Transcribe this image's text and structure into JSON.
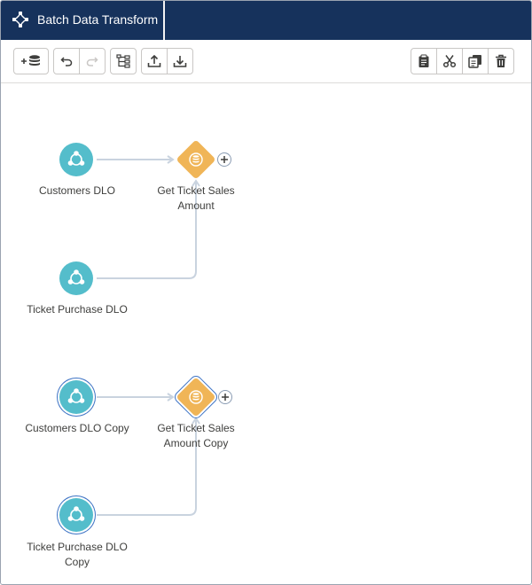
{
  "app": {
    "title": "Batch Data Transform",
    "icon": "transform-icon"
  },
  "toolbar": {
    "add_input_icon": "add-data-icon",
    "undo_icon": "undo-icon",
    "redo_icon": "redo-icon",
    "layout_icon": "auto-layout-icon",
    "upload_icon": "upload-icon",
    "download_icon": "download-icon",
    "paste_icon": "clipboard-icon",
    "cut_icon": "scissors-icon",
    "copy_icon": "copy-icon",
    "delete_icon": "trash-icon"
  },
  "nodes": [
    {
      "id": "customers-dlo",
      "label": "Customers DLO",
      "type": "input",
      "selected": false
    },
    {
      "id": "get-ticket-sales-amount",
      "label": "Get Ticket Sales Amount",
      "type": "join",
      "selected": false
    },
    {
      "id": "ticket-purchase-dlo",
      "label": "Ticket Purchase DLO",
      "type": "input",
      "selected": false
    },
    {
      "id": "customers-dlo-copy",
      "label": "Customers DLO Copy",
      "type": "input",
      "selected": true
    },
    {
      "id": "get-ticket-sales-amount-copy",
      "label": "Get Ticket Sales Amount Copy",
      "type": "join",
      "selected": true
    },
    {
      "id": "ticket-purchase-dlo-copy",
      "label": "Ticket Purchase DLO Copy",
      "type": "input",
      "selected": true
    }
  ],
  "colors": {
    "header": "#16325c",
    "input_node": "#54bdcb",
    "join_node": "#f0b557",
    "selection": "#3d73c5",
    "edge": "#c9d3df"
  }
}
